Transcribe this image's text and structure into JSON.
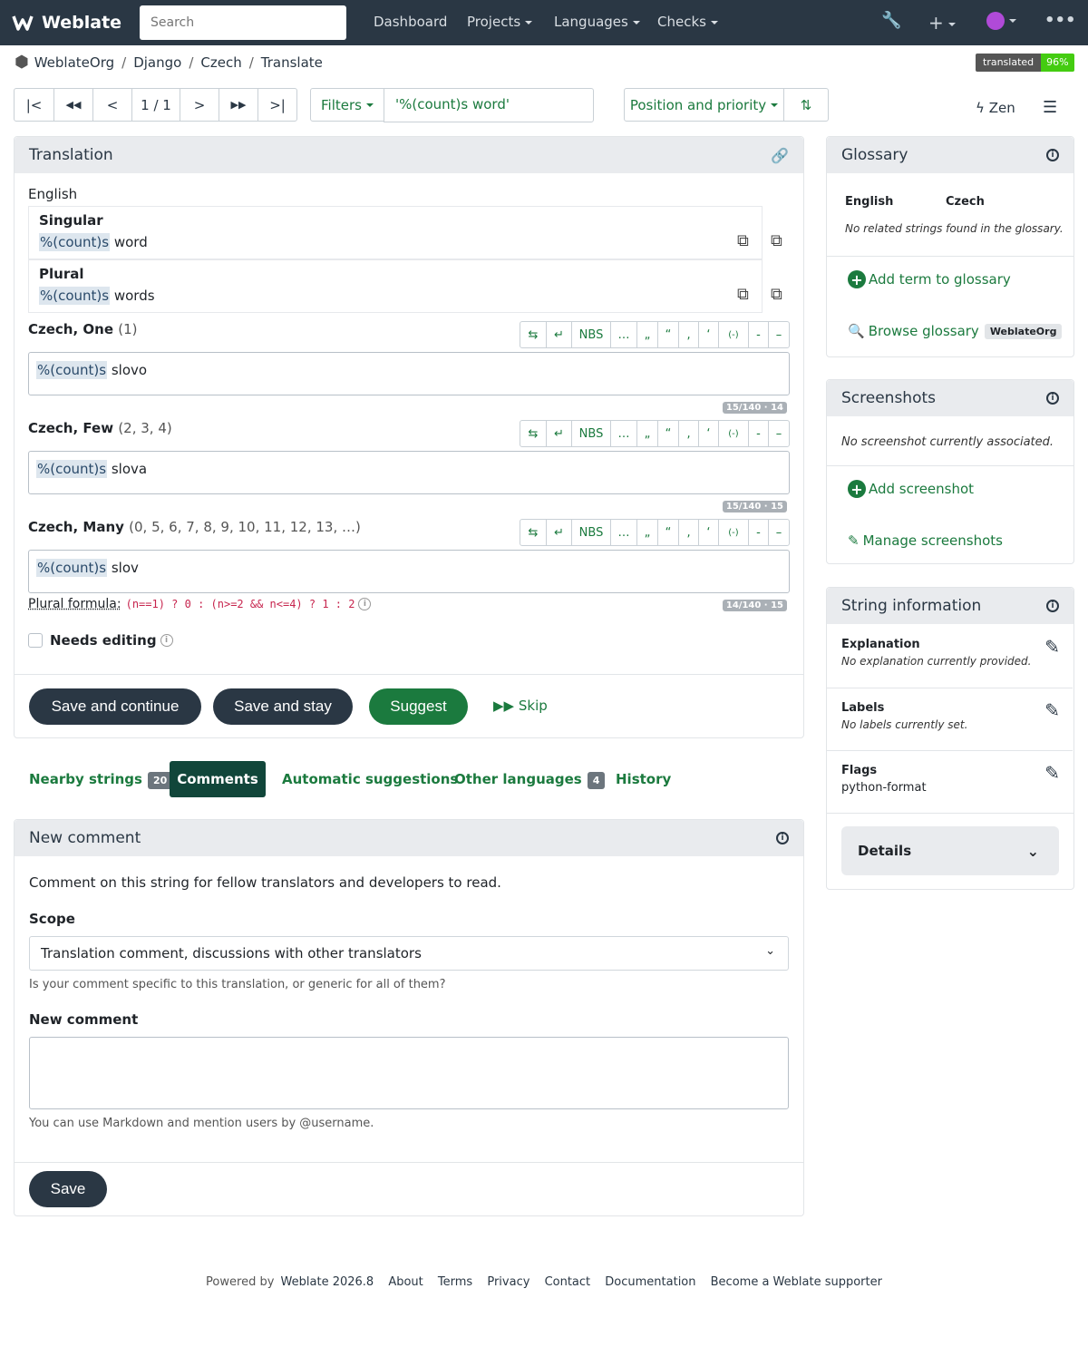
{
  "app": {
    "name": "Weblate"
  },
  "nav": {
    "search_placeholder": "Search",
    "dashboard": "Dashboard",
    "projects": "Projects",
    "languages": "Languages",
    "checks": "Checks"
  },
  "breadcrumb": [
    "WeblateOrg",
    "Django",
    "Czech",
    "Translate"
  ],
  "badge": {
    "label": "translated",
    "value": "96%"
  },
  "pager": {
    "position": "1 / 1"
  },
  "filters": {
    "label": "Filters",
    "query": "'%(count)s word'"
  },
  "sort": {
    "label": "Position and priority"
  },
  "zen": "Zen",
  "translation": {
    "title": "Translation",
    "source_lang": "English",
    "source": [
      {
        "label": "Singular",
        "placeholder": "%(count)s",
        "text": " word"
      },
      {
        "label": "Plural",
        "placeholder": "%(count)s",
        "text": " words"
      }
    ],
    "plurals": [
      {
        "label": "Czech, One",
        "numbers": "(1)",
        "placeholder": "%(count)s",
        "text": " slovo",
        "counter": "15/140 · 14"
      },
      {
        "label": "Czech, Few",
        "numbers": "(2, 3, 4)",
        "placeholder": "%(count)s",
        "text": " slova",
        "counter": "15/140 · 15"
      },
      {
        "label": "Czech, Many",
        "numbers": "(0, 5, 6, 7, 8, 9, 10, 11, 12, 13, …)",
        "placeholder": "%(count)s",
        "text": " slov",
        "counter": "14/140 · 15"
      }
    ],
    "toolbar": [
      "⇆",
      "↵",
      "NBS",
      "…",
      "„",
      "“",
      "‚",
      "‘",
      "(-)",
      "-",
      "–"
    ],
    "plural_formula_label": "Plural formula:",
    "plural_formula": "(n==1) ? 0 : (n>=2 && n<=4) ? 1 : 2",
    "needs_editing": "Needs editing",
    "buttons": {
      "save_continue": "Save and continue",
      "save_stay": "Save and stay",
      "suggest": "Suggest",
      "skip": "Skip"
    }
  },
  "tabs": [
    {
      "label": "Nearby strings",
      "count": "20"
    },
    {
      "label": "Comments"
    },
    {
      "label": "Automatic suggestions"
    },
    {
      "label": "Other languages",
      "count": "4"
    },
    {
      "label": "History"
    }
  ],
  "comment": {
    "title": "New comment",
    "intro": "Comment on this string for fellow translators and developers to read.",
    "scope_label": "Scope",
    "scope_value": "Translation comment, discussions with other translators",
    "scope_help": "Is your comment specific to this translation, or generic for all of them?",
    "new_label": "New comment",
    "new_help": "You can use Markdown and mention users by @username.",
    "save": "Save"
  },
  "glossary": {
    "title": "Glossary",
    "col_en": "English",
    "col_cs": "Czech",
    "empty": "No related strings found in the glossary.",
    "add": "Add term to glossary",
    "browse": "Browse glossary",
    "browse_badge": "WeblateOrg"
  },
  "screenshots": {
    "title": "Screenshots",
    "empty": "No screenshot currently associated.",
    "add": "Add screenshot",
    "manage": "Manage screenshots"
  },
  "info": {
    "title": "String information",
    "explanation_label": "Explanation",
    "explanation": "No explanation currently provided.",
    "labels_label": "Labels",
    "labels": "No labels currently set.",
    "flags_label": "Flags",
    "flags": "python-format",
    "details": "Details"
  },
  "footer": [
    "Powered by",
    "Weblate 2026.8",
    "About",
    "Terms",
    "Privacy",
    "Contact",
    "Documentation",
    "Become a Weblate supporter"
  ],
  "colors": {
    "topbar": "#2a3744",
    "accent": "#1b7a3e",
    "dark_button": "#2a3744",
    "suggest": "#1b7a3e"
  }
}
